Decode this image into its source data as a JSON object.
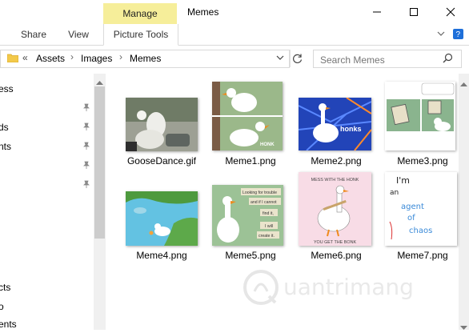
{
  "ribbon": {
    "context_tab": "Manage",
    "tabs": [
      "Share",
      "View",
      "Picture Tools"
    ]
  },
  "window": {
    "title": "Memes"
  },
  "address": {
    "crumb_sep": "«",
    "crumbs": [
      "Assets",
      "Images",
      "Memes"
    ],
    "search_placeholder": "Search Memes"
  },
  "nav": {
    "items": [
      "ess",
      "ds",
      "nts",
      "",
      "",
      "",
      "",
      "",
      "",
      "cts",
      "o",
      "ents"
    ]
  },
  "files": [
    {
      "name": "GooseDance.gif"
    },
    {
      "name": "Meme1.png"
    },
    {
      "name": "Meme2.png"
    },
    {
      "name": "Meme3.png"
    },
    {
      "name": "Meme4.png"
    },
    {
      "name": "Meme5.png"
    },
    {
      "name": "Meme6.png"
    },
    {
      "name": "Meme7.png"
    }
  ],
  "thumb_text": {
    "honk": "HONK",
    "honks": "honks",
    "meme5_lines": [
      "Looking for trouble",
      "and if I cannot",
      "find it,",
      "I will",
      "create it."
    ],
    "meme6_top": "MESS WITH THE HONK",
    "meme6_bottom": "YOU GET THE BONK",
    "meme7_lines": [
      "I'm",
      "an",
      "agent",
      "of",
      "chaos"
    ]
  },
  "watermark": {
    "text": "uantrimang"
  },
  "colors": {
    "manage": "#f6ee9a",
    "accent": "#1e6fd9"
  }
}
